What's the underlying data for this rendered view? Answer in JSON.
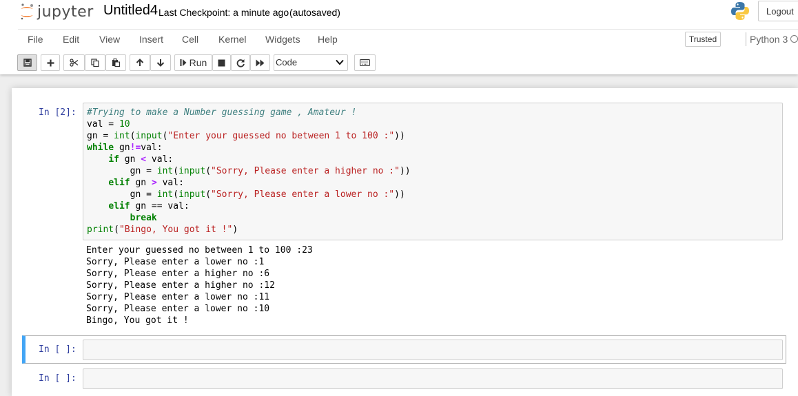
{
  "header": {
    "logo_text": "jupyter",
    "notebook_name": "Untitled4",
    "checkpoint_text": "Last Checkpoint: a minute ago",
    "autosave_status": "(autosaved)",
    "logout_label": "Logout"
  },
  "menubar": {
    "items": [
      "File",
      "Edit",
      "View",
      "Insert",
      "Cell",
      "Kernel",
      "Widgets",
      "Help"
    ],
    "trusted_label": "Trusted",
    "kernel_name": "Python 3"
  },
  "toolbar": {
    "run_label": "Run",
    "cell_type_value": "Code",
    "icons": [
      "save-icon",
      "plus-icon",
      "cut-icon",
      "copy-icon",
      "paste-icon",
      "arrow-up-icon",
      "arrow-down-icon",
      "run-icon",
      "stop-icon",
      "restart-icon",
      "fast-forward-icon",
      "keyboard-icon"
    ]
  },
  "cells": [
    {
      "prompt": "In [2]:",
      "code": [
        "#Trying to make a Number guessing game , Amateur !",
        "val = 10",
        "gn = int(input(\"Enter your guessed no between 1 to 100 :\"))",
        "while gn!=val:",
        "    if gn < val:",
        "        gn = int(input(\"Sorry, Please enter a higher no :\"))",
        "    elif gn > val:",
        "        gn = int(input(\"Sorry, Please enter a lower no :\"))",
        "    elif gn == val:",
        "        break",
        "print(\"Bingo, You got it !\")"
      ],
      "output": [
        "Enter your guessed no between 1 to 100 :23",
        "Sorry, Please enter a lower no :1",
        "Sorry, Please enter a higher no :6",
        "Sorry, Please enter a higher no :12",
        "Sorry, Please enter a lower no :11",
        "Sorry, Please enter a lower no :10",
        "Bingo, You got it !"
      ]
    },
    {
      "prompt": "In [ ]:",
      "code": []
    },
    {
      "prompt": "In [ ]:",
      "code": []
    }
  ],
  "colors": {
    "prompt": "#303f9f",
    "selected_cell_bar": "#42a5f5",
    "keyword": "#008000",
    "string": "#ba2121",
    "comment": "#408080",
    "operator": "#aa22ff"
  }
}
